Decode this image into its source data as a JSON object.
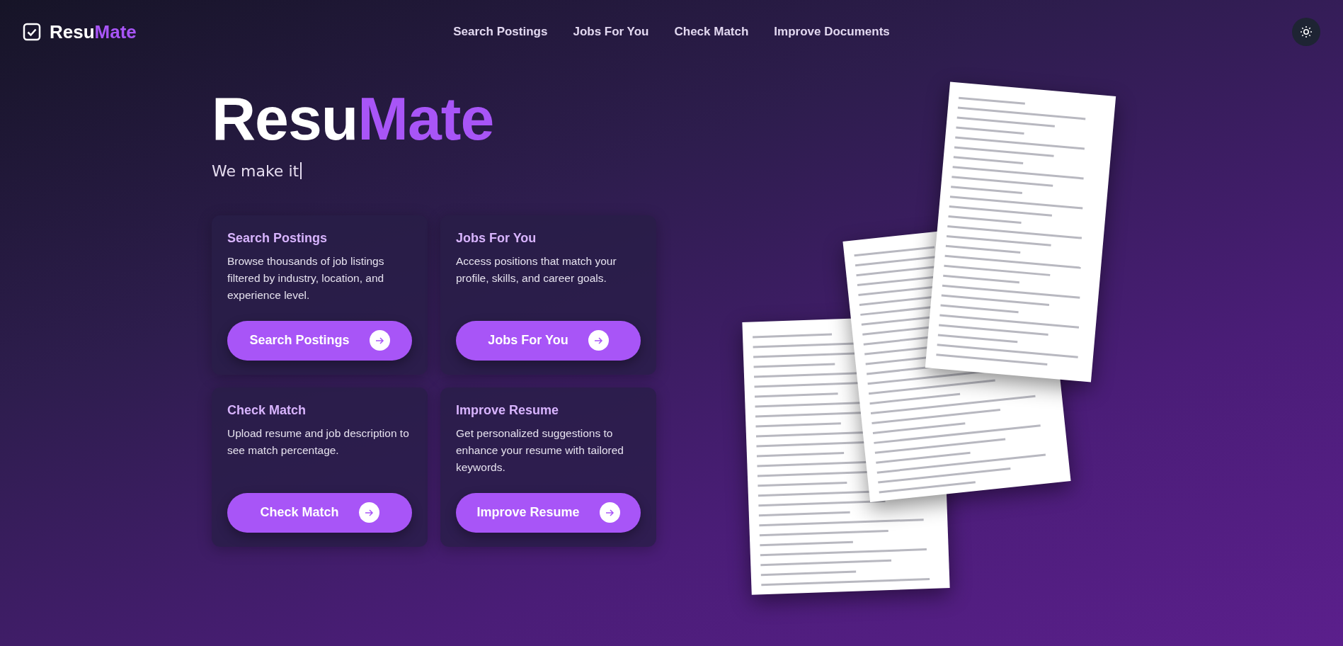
{
  "header": {
    "logo": {
      "first": "Resu",
      "second": "Mate"
    },
    "nav": [
      "Search Postings",
      "Jobs For You",
      "Check Match",
      "Improve Documents"
    ]
  },
  "hero": {
    "title_first": "Resu",
    "title_second": "Mate",
    "tagline": "We make it"
  },
  "cards": [
    {
      "title": "Search Postings",
      "description": "Browse thousands of job listings filtered by industry, location, and experience level.",
      "button": "Search Postings"
    },
    {
      "title": "Jobs For You",
      "description": "Access positions that match your profile, skills, and career goals.",
      "button": "Jobs For You"
    },
    {
      "title": "Check Match",
      "description": "Upload resume and job description to see match percentage.",
      "button": "Check Match"
    },
    {
      "title": "Improve Resume",
      "description": "Get personalized suggestions to enhance your resume with tailored keywords.",
      "button": "Improve Resume"
    }
  ]
}
